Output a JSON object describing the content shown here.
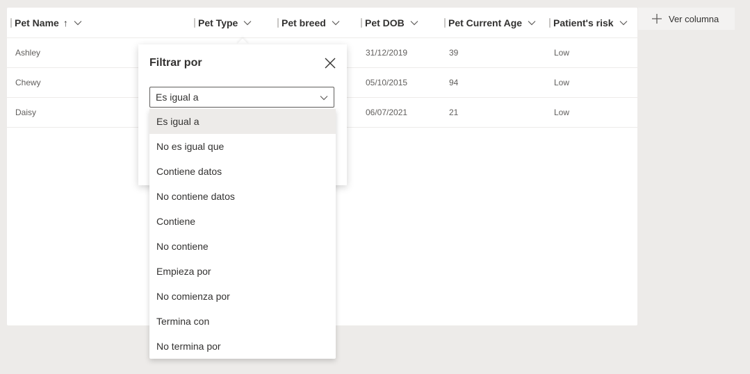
{
  "columns": [
    {
      "label": "Pet Name",
      "sort_indicator": "↑"
    },
    {
      "label": "Pet Type"
    },
    {
      "label": "Pet breed"
    },
    {
      "label": "Pet DOB"
    },
    {
      "label": "Pet Current Age"
    },
    {
      "label": "Patient's risk"
    }
  ],
  "rows": [
    {
      "name": "Ashley",
      "dob": "31/12/2019",
      "age": "39",
      "risk": "Low"
    },
    {
      "name": "Chewy",
      "dob": "05/10/2015",
      "age": "94",
      "risk": "Low"
    },
    {
      "name": "Daisy",
      "dob": "06/07/2021",
      "age": "21",
      "risk": "Low"
    }
  ],
  "add_column": {
    "label": "Ver columna",
    "icon": "plus-icon"
  },
  "filter": {
    "title": "Filtrar por",
    "close_icon": "close-icon",
    "selected": "Es igual a",
    "options": [
      "Es igual a",
      "No es igual que",
      "Contiene datos",
      "No contiene datos",
      "Contiene",
      "No contiene",
      "Empieza por",
      "No comienza por",
      "Termina con",
      "No termina por"
    ]
  }
}
